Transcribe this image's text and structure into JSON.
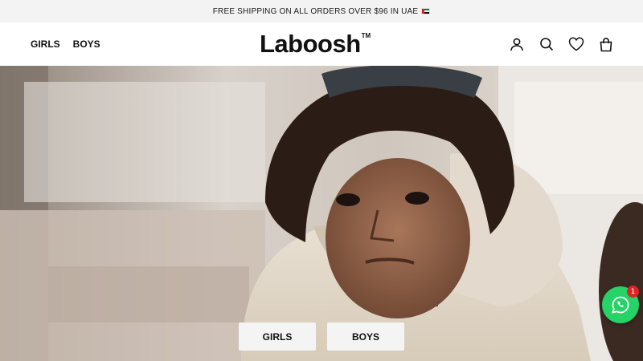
{
  "announcement": {
    "text": "FREE SHIPPING ON ALL ORDERS OVER $96 IN UAE",
    "flag_icon": "uae-flag-icon"
  },
  "header": {
    "nav": [
      {
        "label": "GIRLS"
      },
      {
        "label": "BOYS"
      }
    ],
    "logo": {
      "text": "Laboosh",
      "tm": "TM"
    },
    "icons": [
      "account-icon",
      "search-icon",
      "wishlist-heart-icon",
      "cart-bag-icon"
    ]
  },
  "hero": {
    "buttons": [
      {
        "label": "GIRLS"
      },
      {
        "label": "BOYS"
      }
    ]
  },
  "whatsapp": {
    "badge_count": "1",
    "icon": "whatsapp-icon",
    "color": "#25d366"
  },
  "colors": {
    "announcement_bg": "#f3f3f3",
    "button_bg": "#f4f4f4",
    "badge": "#e02424"
  }
}
